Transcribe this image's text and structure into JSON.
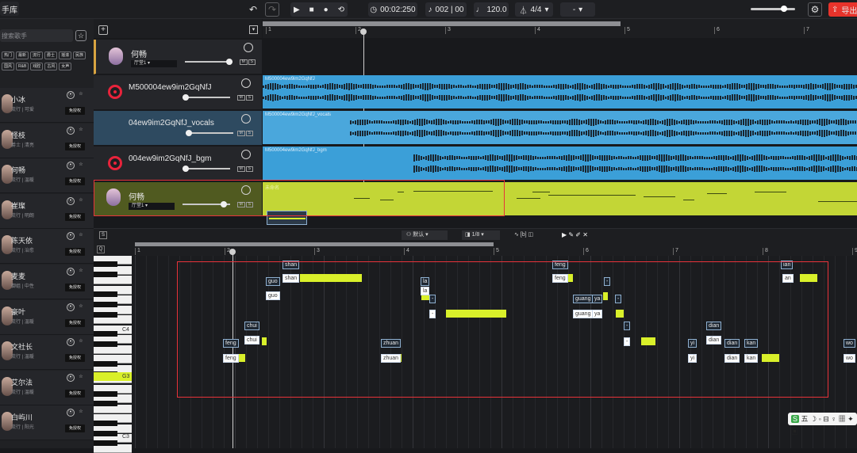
{
  "app": {
    "left_title": "手库",
    "export_label": "导出"
  },
  "transport": {
    "time": "00:02:250",
    "bar_beat": "002 | 00",
    "bpm": "120.0",
    "time_sig": "4/4",
    "key": "-"
  },
  "library": {
    "search_placeholder": "搜索歌手",
    "tags": [
      "热门",
      "最新",
      "流行",
      "爵士",
      "摇滚",
      "民族",
      "国风",
      "R&B",
      "戏腔",
      "古风",
      "女声"
    ],
    "singers": [
      {
        "name": "小冰",
        "tag": "流行 | 可爱",
        "btn": "免授权"
      },
      {
        "name": "怪枝",
        "tag": "爵士 | 清亮",
        "btn": "免授权"
      },
      {
        "name": "何畅",
        "tag": "流行 | 温暖",
        "btn": "免授权"
      },
      {
        "name": "崔璨",
        "tag": "流行 | 明朗",
        "btn": "免授权"
      },
      {
        "name": "陈天依",
        "tag": "流行 | 治愈",
        "btn": "免授权"
      },
      {
        "name": "麦麦",
        "tag": "御姐 | 中性",
        "btn": "免授权"
      },
      {
        "name": "豪叶",
        "tag": "流行 | 温暖",
        "btn": "免授权"
      },
      {
        "name": "文社长",
        "tag": "流行 | 温暖",
        "btn": "免授权"
      },
      {
        "name": "艾尔法",
        "tag": "流行 | 温暖",
        "btn": "免授权"
      },
      {
        "name": "白屿川",
        "tag": "流行 | 阳光",
        "btn": "免授权"
      }
    ]
  },
  "tracks": [
    {
      "name": "何畅",
      "preset": "厅堂1"
    },
    {
      "name": "M500004ew9im2GqNfJ",
      "clip": "M500004ew9im2GqNfJ"
    },
    {
      "name": "04ew9im2GqNfJ_vocals",
      "clip": "M500004ew9im2GqNfJ_vocals"
    },
    {
      "name": "004ew9im2GqNfJ_bgm",
      "clip": "M500004ew9im2GqNfJ_bgm"
    },
    {
      "name": "何畅",
      "preset": "厅堂1",
      "clip": "未命名"
    }
  ],
  "ruler": [
    "1",
    "2",
    "3",
    "4",
    "5",
    "6",
    "7"
  ],
  "editor": {
    "ruler": [
      "1",
      "2",
      "3",
      "4",
      "5",
      "6",
      "7",
      "8",
      "9"
    ],
    "mode": "默认",
    "quant": "1/8",
    "piano_labels": [
      "C4",
      "G3",
      "C3"
    ],
    "syllables_top": [
      "shan",
      "guo",
      "la",
      "feng",
      "-",
      "-",
      "guang",
      "ya",
      "-",
      "chui",
      "feng",
      "zhuan",
      "-",
      "yi",
      "dian",
      "dian",
      "kan",
      "ian",
      "wo"
    ],
    "syllables_bot": [
      "shan",
      "guo",
      "la",
      "feng",
      "-",
      "guang",
      "ya",
      "-",
      "chui",
      "feng",
      "zhuan",
      "yi",
      "dian",
      "dian",
      "kan",
      "an",
      "wo"
    ]
  },
  "ime": {
    "label": "五"
  },
  "colors": {
    "accent": "#d9f02a",
    "lane": "#3b9fd8",
    "export": "#e8332b",
    "highlight": "#e8333a"
  }
}
